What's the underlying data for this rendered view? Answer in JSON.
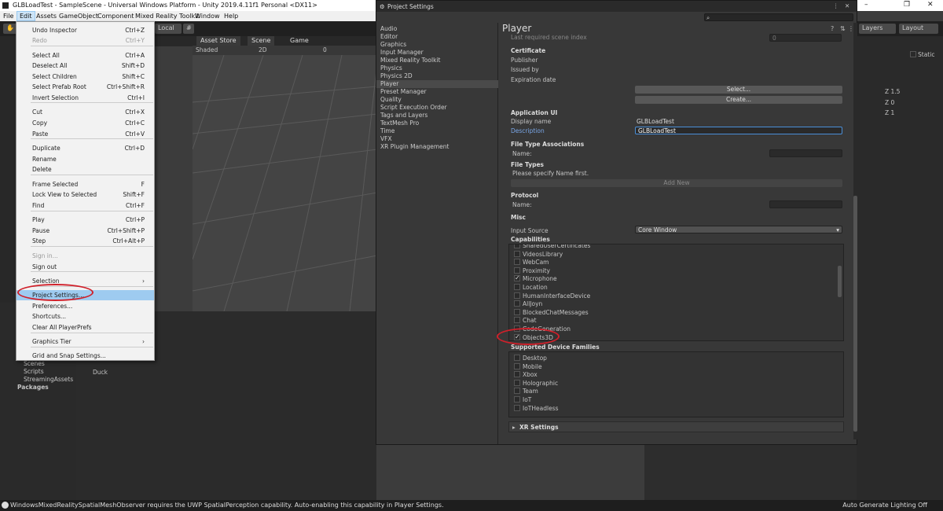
{
  "window": {
    "title": "GLBLoadTest - SampleScene - Universal Windows Platform - Unity 2019.4.11f1 Personal <DX11>",
    "controls": [
      "–",
      "❐",
      "✕"
    ]
  },
  "menubar": [
    "File",
    "Edit",
    "Assets",
    "GameObject",
    "Component",
    "Mixed Reality Toolkit",
    "Window",
    "Help"
  ],
  "toolbar": {
    "local": "Local",
    "layers": "Layers",
    "layout": "Layout"
  },
  "scene_tabs": {
    "asset_store": "Asset Store",
    "scene": "Scene",
    "game": "Game",
    "shaded": "Shaded",
    "mode_2d": "2D",
    "gizmo_count": "0"
  },
  "edit_menu": [
    {
      "label": "Undo Inspector",
      "shortcut": "Ctrl+Z"
    },
    {
      "label": "Redo",
      "shortcut": "Ctrl+Y",
      "disabled": true
    },
    {
      "label": "Select All",
      "shortcut": "Ctrl+A"
    },
    {
      "label": "Deselect All",
      "shortcut": "Shift+D"
    },
    {
      "label": "Select Children",
      "shortcut": "Shift+C"
    },
    {
      "label": "Select Prefab Root",
      "shortcut": "Ctrl+Shift+R"
    },
    {
      "label": "Invert Selection",
      "shortcut": "Ctrl+I"
    },
    {
      "label": "Cut",
      "shortcut": "Ctrl+X"
    },
    {
      "label": "Copy",
      "shortcut": "Ctrl+C"
    },
    {
      "label": "Paste",
      "shortcut": "Ctrl+V"
    },
    {
      "label": "Duplicate",
      "shortcut": "Ctrl+D"
    },
    {
      "label": "Rename",
      "shortcut": ""
    },
    {
      "label": "Delete",
      "shortcut": ""
    },
    {
      "label": "Frame Selected",
      "shortcut": "F"
    },
    {
      "label": "Lock View to Selected",
      "shortcut": "Shift+F"
    },
    {
      "label": "Find",
      "shortcut": "Ctrl+F"
    },
    {
      "label": "Play",
      "shortcut": "Ctrl+P"
    },
    {
      "label": "Pause",
      "shortcut": "Ctrl+Shift+P"
    },
    {
      "label": "Step",
      "shortcut": "Ctrl+Alt+P"
    },
    {
      "label": "Sign in...",
      "shortcut": "",
      "disabled": true
    },
    {
      "label": "Sign out",
      "shortcut": ""
    },
    {
      "label": "Selection",
      "shortcut": "›"
    },
    {
      "label": "Project Settings...",
      "shortcut": "",
      "highlighted": true
    },
    {
      "label": "Preferences...",
      "shortcut": ""
    },
    {
      "label": "Shortcuts...",
      "shortcut": ""
    },
    {
      "label": "Clear All PlayerPrefs",
      "shortcut": ""
    },
    {
      "label": "Graphics Tier",
      "shortcut": "›"
    },
    {
      "label": "Grid and Snap Settings...",
      "shortcut": ""
    }
  ],
  "project_tree": [
    "Scenes",
    "Scripts",
    "StreamingAssets",
    "Packages"
  ],
  "project_item": "Duck",
  "project_settings": {
    "title": "Project Settings",
    "nav": [
      "Audio",
      "Editor",
      "Graphics",
      "Input Manager",
      "Mixed Reality Toolkit",
      "Physics",
      "Physics 2D",
      "Player",
      "Preset Manager",
      "Quality",
      "Script Execution Order",
      "Tags and Layers",
      "TextMesh Pro",
      "Time",
      "VFX",
      "XR Plugin Management"
    ],
    "selected_nav": "Player",
    "heading": "Player",
    "last_required_scene_index": {
      "label": "Last required scene index",
      "value": "0"
    },
    "certificate": {
      "header": "Certificate",
      "publisher": "Publisher",
      "issued_by": "Issued by",
      "expiration": "Expiration date",
      "select_btn": "Select...",
      "create_btn": "Create..."
    },
    "application_ui": {
      "header": "Application UI",
      "display_name_label": "Display name",
      "display_name": "GLBLoadTest",
      "description_label": "Description",
      "description": "GLBLoadTest"
    },
    "file_type_assoc": {
      "header": "File Type Associations",
      "name_label": "Name:"
    },
    "file_types": {
      "header": "File Types",
      "hint": "Please specify Name first.",
      "add_new": "Add New"
    },
    "protocol": {
      "header": "Protocol",
      "name_label": "Name:"
    },
    "misc": {
      "header": "Misc",
      "input_source_label": "Input Source",
      "input_source": "Core Window"
    },
    "capabilities": {
      "header": "Capabilities",
      "items": [
        {
          "name": "SharedUserCertificates",
          "checked": false
        },
        {
          "name": "VideosLibrary",
          "checked": false
        },
        {
          "name": "WebCam",
          "checked": false
        },
        {
          "name": "Proximity",
          "checked": false
        },
        {
          "name": "Microphone",
          "checked": true
        },
        {
          "name": "Location",
          "checked": false
        },
        {
          "name": "HumanInterfaceDevice",
          "checked": false
        },
        {
          "name": "AllJoyn",
          "checked": false
        },
        {
          "name": "BlockedChatMessages",
          "checked": false
        },
        {
          "name": "Chat",
          "checked": false
        },
        {
          "name": "CodeGeneration",
          "checked": false
        },
        {
          "name": "Objects3D",
          "checked": true
        }
      ]
    },
    "device_families": {
      "header": "Supported Device Families",
      "items": [
        {
          "name": "Desktop",
          "checked": false
        },
        {
          "name": "Mobile",
          "checked": false
        },
        {
          "name": "Xbox",
          "checked": false
        },
        {
          "name": "Holographic",
          "checked": false
        },
        {
          "name": "Team",
          "checked": false
        },
        {
          "name": "IoT",
          "checked": false
        },
        {
          "name": "IoTHeadless",
          "checked": false
        }
      ]
    },
    "xr_settings": "XR Settings"
  },
  "inspector": {
    "static": "Static",
    "z1": "Z  1.5",
    "z2": "Z  0",
    "z3": "Z  1"
  },
  "status": {
    "message": "WindowsMixedRealitySpatialMeshObserver requires the UWP SpatialPerception capability. Auto-enabling this capability in Player Settings.",
    "right": "Auto Generate Lighting Off"
  },
  "colors": {
    "highlight": "#9ecbf0",
    "annotation_ring": "#d0202a",
    "selection_field": "#4a8fd8"
  }
}
